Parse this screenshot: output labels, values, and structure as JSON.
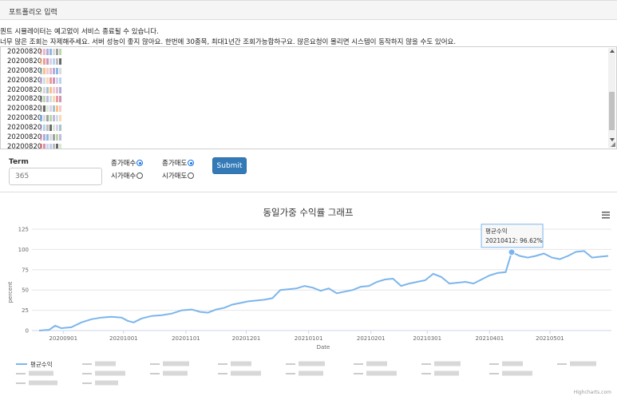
{
  "panel": {
    "title": "포트폴리오 입력"
  },
  "notices": [
    "퀀트 시뮬레이터는 예고없이 서비스 종료될 수 있습니다.",
    "너무 많은 조회는 자제해주세요. 서버 성능이 좋지 않아요. 한번에 30종목, 최대1년간 조회가능합하구요. 많은요청이 몰리면 시스템이 동작하지 않을 수도 있어요."
  ],
  "portfolio_lines": [
    "20200820",
    "20200820",
    "20200820",
    "20200820",
    "20200820",
    "20200820",
    "20200820",
    "20200820",
    "20200820",
    "20200820",
    "20200820"
  ],
  "form": {
    "term_label": "Term",
    "term_placeholder": "365",
    "radios": [
      {
        "label": "종가매수",
        "checked": true
      },
      {
        "label": "종가매도",
        "checked": true
      },
      {
        "label": "시가매수",
        "checked": false
      },
      {
        "label": "시가매도",
        "checked": false
      }
    ],
    "submit_label": "Submit"
  },
  "chart_data": {
    "type": "line",
    "title": "동일가중 수익률 그래프",
    "xlabel": "Date",
    "ylabel": "percent",
    "ylim": [
      0,
      125
    ],
    "yticks": [
      "0",
      "25",
      "50",
      "75",
      "100",
      "125"
    ],
    "x_ticks": [
      "20200901",
      "20201001",
      "20201101",
      "20201201",
      "20210101",
      "20210201",
      "20210301",
      "20210401",
      "20210501"
    ],
    "grid": true,
    "legend_position": "bottom",
    "series": [
      {
        "name": "평균수익",
        "color": "#7cb5ec",
        "points": [
          [
            "20200820",
            0
          ],
          [
            "20200825",
            1
          ],
          [
            "20200828",
            6
          ],
          [
            "20200831",
            3
          ],
          [
            "20200905",
            4
          ],
          [
            "20200910",
            10
          ],
          [
            "20200915",
            14
          ],
          [
            "20200920",
            16
          ],
          [
            "20200925",
            17
          ],
          [
            "20200930",
            16
          ],
          [
            "20201003",
            12
          ],
          [
            "20201006",
            10
          ],
          [
            "20201010",
            15
          ],
          [
            "20201015",
            18
          ],
          [
            "20201020",
            19
          ],
          [
            "20201025",
            21
          ],
          [
            "20201030",
            25
          ],
          [
            "20201104",
            26
          ],
          [
            "20201108",
            23
          ],
          [
            "20201112",
            22
          ],
          [
            "20201116",
            26
          ],
          [
            "20201120",
            28
          ],
          [
            "20201124",
            32
          ],
          [
            "20201128",
            34
          ],
          [
            "20201202",
            36
          ],
          [
            "20201206",
            37
          ],
          [
            "20201210",
            38
          ],
          [
            "20201214",
            40
          ],
          [
            "20201218",
            50
          ],
          [
            "20201222",
            51
          ],
          [
            "20201226",
            52
          ],
          [
            "20201230",
            55
          ],
          [
            "20210103",
            53
          ],
          [
            "20210107",
            49
          ],
          [
            "20210111",
            52
          ],
          [
            "20210115",
            46
          ],
          [
            "20210119",
            48
          ],
          [
            "20210123",
            50
          ],
          [
            "20210127",
            54
          ],
          [
            "20210131",
            55
          ],
          [
            "20210204",
            60
          ],
          [
            "20210208",
            63
          ],
          [
            "20210212",
            64
          ],
          [
            "20210216",
            55
          ],
          [
            "20210220",
            58
          ],
          [
            "20210224",
            60
          ],
          [
            "20210228",
            62
          ],
          [
            "20210304",
            70
          ],
          [
            "20210308",
            66
          ],
          [
            "20210312",
            58
          ],
          [
            "20210316",
            59
          ],
          [
            "20210320",
            60
          ],
          [
            "20210324",
            58
          ],
          [
            "20210328",
            63
          ],
          [
            "20210401",
            68
          ],
          [
            "20210405",
            71
          ],
          [
            "20210409",
            72
          ],
          [
            "20210412",
            96.62
          ],
          [
            "20210416",
            92
          ],
          [
            "20210420",
            90
          ],
          [
            "20210424",
            92
          ],
          [
            "20210428",
            95
          ],
          [
            "20210502",
            90
          ],
          [
            "20210506",
            88
          ],
          [
            "20210510",
            92
          ],
          [
            "20210514",
            97
          ],
          [
            "20210518",
            98
          ],
          [
            "20210522",
            90
          ],
          [
            "20210526",
            91
          ],
          [
            "20210530",
            92
          ]
        ]
      }
    ],
    "tooltip": {
      "series": "평균수익",
      "x": "20210412",
      "value_text": "96.62%"
    },
    "credits": "Highcharts.com"
  },
  "legend_main": "평균수익",
  "icons": {
    "menu": "hamburger-menu-icon"
  }
}
